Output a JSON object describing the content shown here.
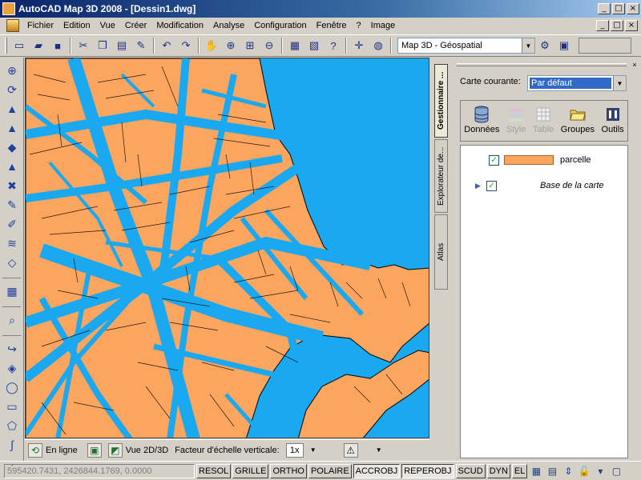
{
  "window": {
    "title": "AutoCAD Map 3D 2008 - [Dessin1.dwg]",
    "minimize": "_",
    "maximize": "□",
    "close": "×"
  },
  "menu": {
    "items": [
      "Fichier",
      "Edition",
      "Vue",
      "Créer",
      "Modification",
      "Analyse",
      "Configuration",
      "Fenêtre",
      "?",
      "Image"
    ]
  },
  "toolbar": {
    "workspace": "Map 3D - Géospatial"
  },
  "taskpane": {
    "tabs": [
      "Gestionnaire ...",
      "Explorateur de...",
      "Atlas"
    ],
    "current_map_label": "Carte courante:",
    "current_map_value": "Par défaut",
    "tools": [
      {
        "label": "Données",
        "icon": "database-icon",
        "enabled": true
      },
      {
        "label": "Style",
        "icon": "style-icon",
        "enabled": false
      },
      {
        "label": "Table",
        "icon": "table-icon",
        "enabled": false
      },
      {
        "label": "Groupes",
        "icon": "folder-icon",
        "enabled": true
      },
      {
        "label": "Outils",
        "icon": "tools-icon",
        "enabled": true
      }
    ],
    "layers": [
      {
        "name": "parcelle",
        "checked": true
      },
      {
        "name": "Base de la carte",
        "checked": true
      }
    ]
  },
  "mapstatus": {
    "online": "En ligne",
    "view": "Vue 2D/3D",
    "scale_label": "Facteur d'échelle verticale:",
    "scale_value": "1x"
  },
  "statusbar": {
    "coords": "595420.7431, 2426844.1769, 0.0000",
    "buttons": [
      "RESOL",
      "GRILLE",
      "ORTHO",
      "POLAIRE",
      "ACCROBJ",
      "REPEROBJ",
      "SCUD",
      "DYN",
      "EL"
    ],
    "pressed": [
      "ACCROBJ",
      "REPEROBJ"
    ]
  },
  "colors": {
    "water": "#1aa9f0",
    "parcel": "#fca55e"
  }
}
